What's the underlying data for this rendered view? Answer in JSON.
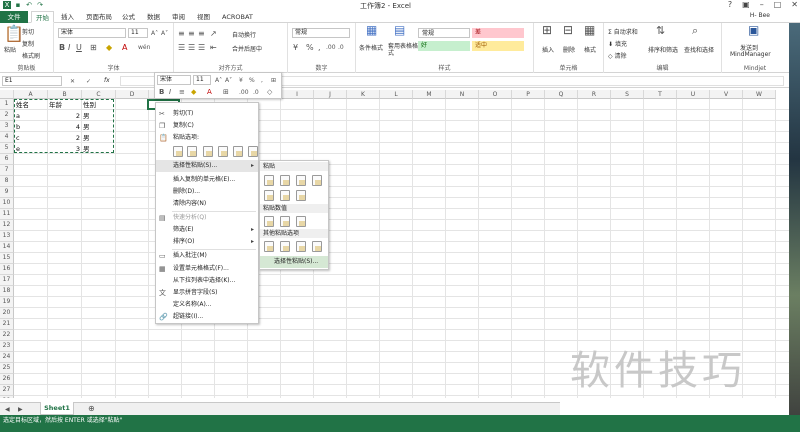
{
  "app": {
    "title": "工作簿2 - Excel",
    "user": "H- Bee"
  },
  "tabs": [
    "文件",
    "开始",
    "插入",
    "页面布局",
    "公式",
    "数据",
    "审阅",
    "视图",
    "ACROBAT"
  ],
  "ribbon": {
    "clipboard": {
      "paste": "粘贴",
      "cut": "剪切",
      "copy": "复制",
      "format_painter": "格式刷",
      "label": "剪贴板"
    },
    "font": {
      "name": "宋体",
      "size": "11",
      "label": "字体"
    },
    "alignment": {
      "wrap": "自动换行",
      "merge": "合并后居中",
      "label": "对齐方式"
    },
    "number": {
      "format": "常规",
      "label": "数字"
    },
    "styles": {
      "conditional": "条件格式",
      "table": "套用表格格式",
      "normal": "常规",
      "bad": "差",
      "good": "好",
      "neutral": "适中",
      "label": "样式"
    },
    "cells": {
      "insert": "插入",
      "delete": "删除",
      "format": "格式",
      "label": "单元格"
    },
    "editing": {
      "autosum": "自动求和",
      "fill": "填充",
      "clear": "清除",
      "sort": "排序和筛选",
      "find": "查找和选择",
      "label": "编辑"
    },
    "mindjet": {
      "send": "发送到",
      "app": "MindManager",
      "label": "Mindjet"
    }
  },
  "formula_bar": {
    "name_box": "E1",
    "fx": "fx"
  },
  "columns": [
    "A",
    "B",
    "C",
    "D",
    "E",
    "F",
    "G",
    "H",
    "I",
    "J",
    "K",
    "L",
    "M",
    "N",
    "O",
    "P",
    "Q",
    "R",
    "S",
    "T",
    "U",
    "V",
    "W"
  ],
  "rows": [
    "1",
    "2",
    "3",
    "4",
    "5",
    "6",
    "7",
    "8",
    "9",
    "10",
    "11",
    "12",
    "13",
    "14",
    "15",
    "16",
    "17",
    "18",
    "19",
    "20",
    "21",
    "22",
    "23",
    "24",
    "25",
    "26",
    "27",
    "28",
    "29"
  ],
  "cells": {
    "headers": [
      "姓名",
      "年龄",
      "性别"
    ],
    "data": [
      [
        "a",
        "2",
        "男"
      ],
      [
        "b",
        "4",
        "男"
      ],
      [
        "c",
        "2",
        "男"
      ],
      [
        "e",
        "3",
        "男"
      ]
    ]
  },
  "mini_toolbar": {
    "font": "宋体",
    "size": "11"
  },
  "context_menu": {
    "items": [
      "剪切(T)",
      "复制(C)",
      "粘贴选项:",
      "选择性粘贴(S)...",
      "插入复制的单元格(E)...",
      "删除(D)...",
      "清除内容(N)",
      "快速分析(Q)",
      "筛选(E)",
      "排序(O)",
      "插入批注(M)",
      "设置单元格格式(F)...",
      "从下拉列表中选择(K)...",
      "显示拼音字段(S)",
      "定义名称(A)...",
      "超链接(I)..."
    ]
  },
  "submenu": {
    "paste": "粘贴",
    "paste_values": "粘贴数值",
    "other": "其他粘贴选项",
    "special": "选择性粘贴(S)..."
  },
  "sheet": {
    "tab": "Sheet1"
  },
  "status": "选定目标区域，然后按 ENTER 或选择\"粘贴\"",
  "watermark": "软件技巧",
  "colors": {
    "excel_green": "#217346",
    "style_normal": "#ffffff",
    "style_bad": "#ffc7ce",
    "style_good": "#c6efce",
    "style_neutral": "#ffeb9c"
  }
}
